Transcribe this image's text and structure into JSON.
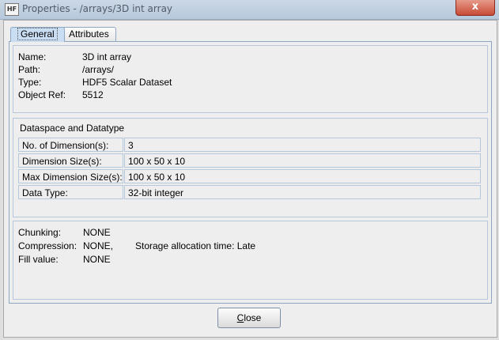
{
  "window": {
    "title": "Properties - /arrays/3D int array",
    "app_icon_text": "HF",
    "close_glyph": "x"
  },
  "tabs": [
    {
      "label": "General",
      "selected": true
    },
    {
      "label": "Attributes",
      "selected": false
    }
  ],
  "object_info": [
    {
      "label": "Name:",
      "value": "3D int array"
    },
    {
      "label": "Path:",
      "value": "/arrays/"
    },
    {
      "label": "Type:",
      "value": "HDF5 Scalar Dataset"
    },
    {
      "label": "Object Ref:",
      "value": "5512"
    }
  ],
  "dataspace": {
    "title": "Dataspace and Datatype",
    "rows": [
      {
        "label": "No. of Dimension(s):",
        "value": "3"
      },
      {
        "label": "Dimension Size(s):",
        "value": "100 x 50 x 10"
      },
      {
        "label": "Max Dimension Size(s):",
        "value": "100 x 50 x 10"
      },
      {
        "label": "Data Type:",
        "value": "32-bit integer"
      }
    ]
  },
  "storage": {
    "chunking_label": "Chunking:",
    "chunking_value": "NONE",
    "compression_label": "Compression:",
    "compression_value": "NONE,",
    "allocation_text": "Storage allocation time: Late",
    "fill_label": "Fill value:",
    "fill_value": "NONE"
  },
  "buttons": {
    "close_mnemonic": "C",
    "close_rest": "lose"
  },
  "colors": {
    "titlebar": "#b6c8db",
    "tab_selected": "#c9ddf3",
    "panel_border": "#8ea6c2",
    "close_red": "#c74b35"
  }
}
